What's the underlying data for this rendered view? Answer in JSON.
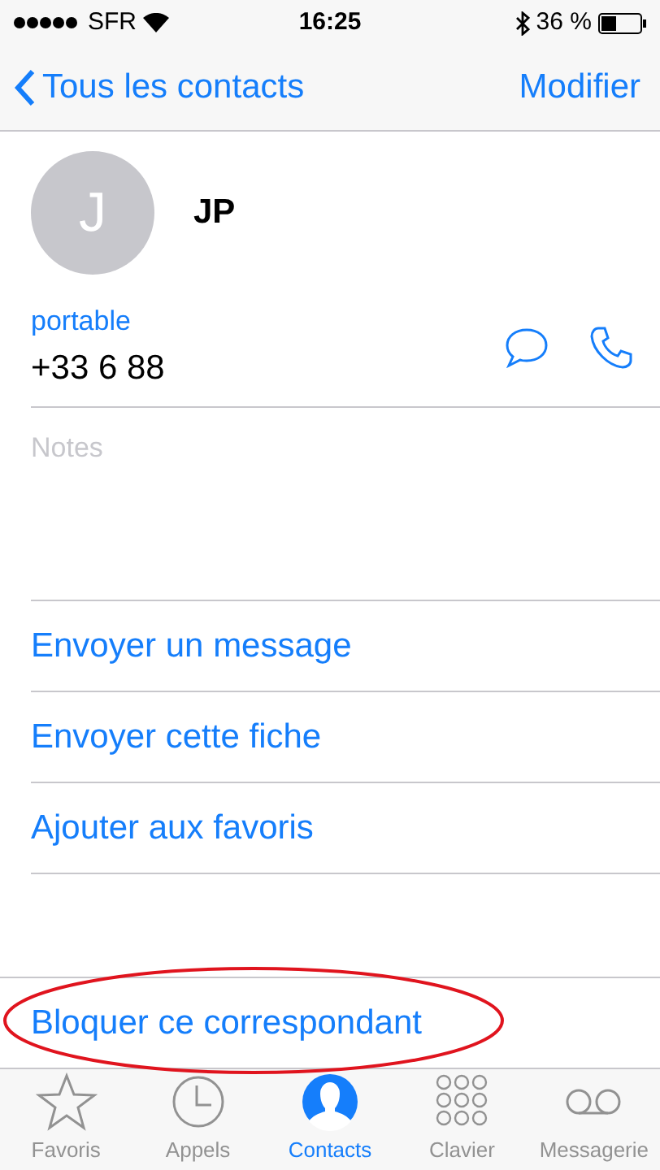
{
  "status_bar": {
    "carrier": "SFR",
    "time": "16:25",
    "battery": "36 %"
  },
  "nav": {
    "back": "Tous les contacts",
    "action": "Modifier"
  },
  "contact": {
    "initial": "J",
    "name": "JP"
  },
  "phone": {
    "label": "portable",
    "number": "+33 6 88"
  },
  "notes": {
    "placeholder": "Notes"
  },
  "actions": [
    "Envoyer un message",
    "Envoyer cette fiche",
    "Ajouter aux favoris"
  ],
  "block_action": {
    "label": "Bloquer ce correspondant",
    "highlighted": true
  },
  "tabs": [
    {
      "label": "Favoris",
      "selected": false
    },
    {
      "label": "Appels",
      "selected": false
    },
    {
      "label": "Contacts",
      "selected": true
    },
    {
      "label": "Clavier",
      "selected": false
    },
    {
      "label": "Messagerie",
      "selected": false
    }
  ]
}
